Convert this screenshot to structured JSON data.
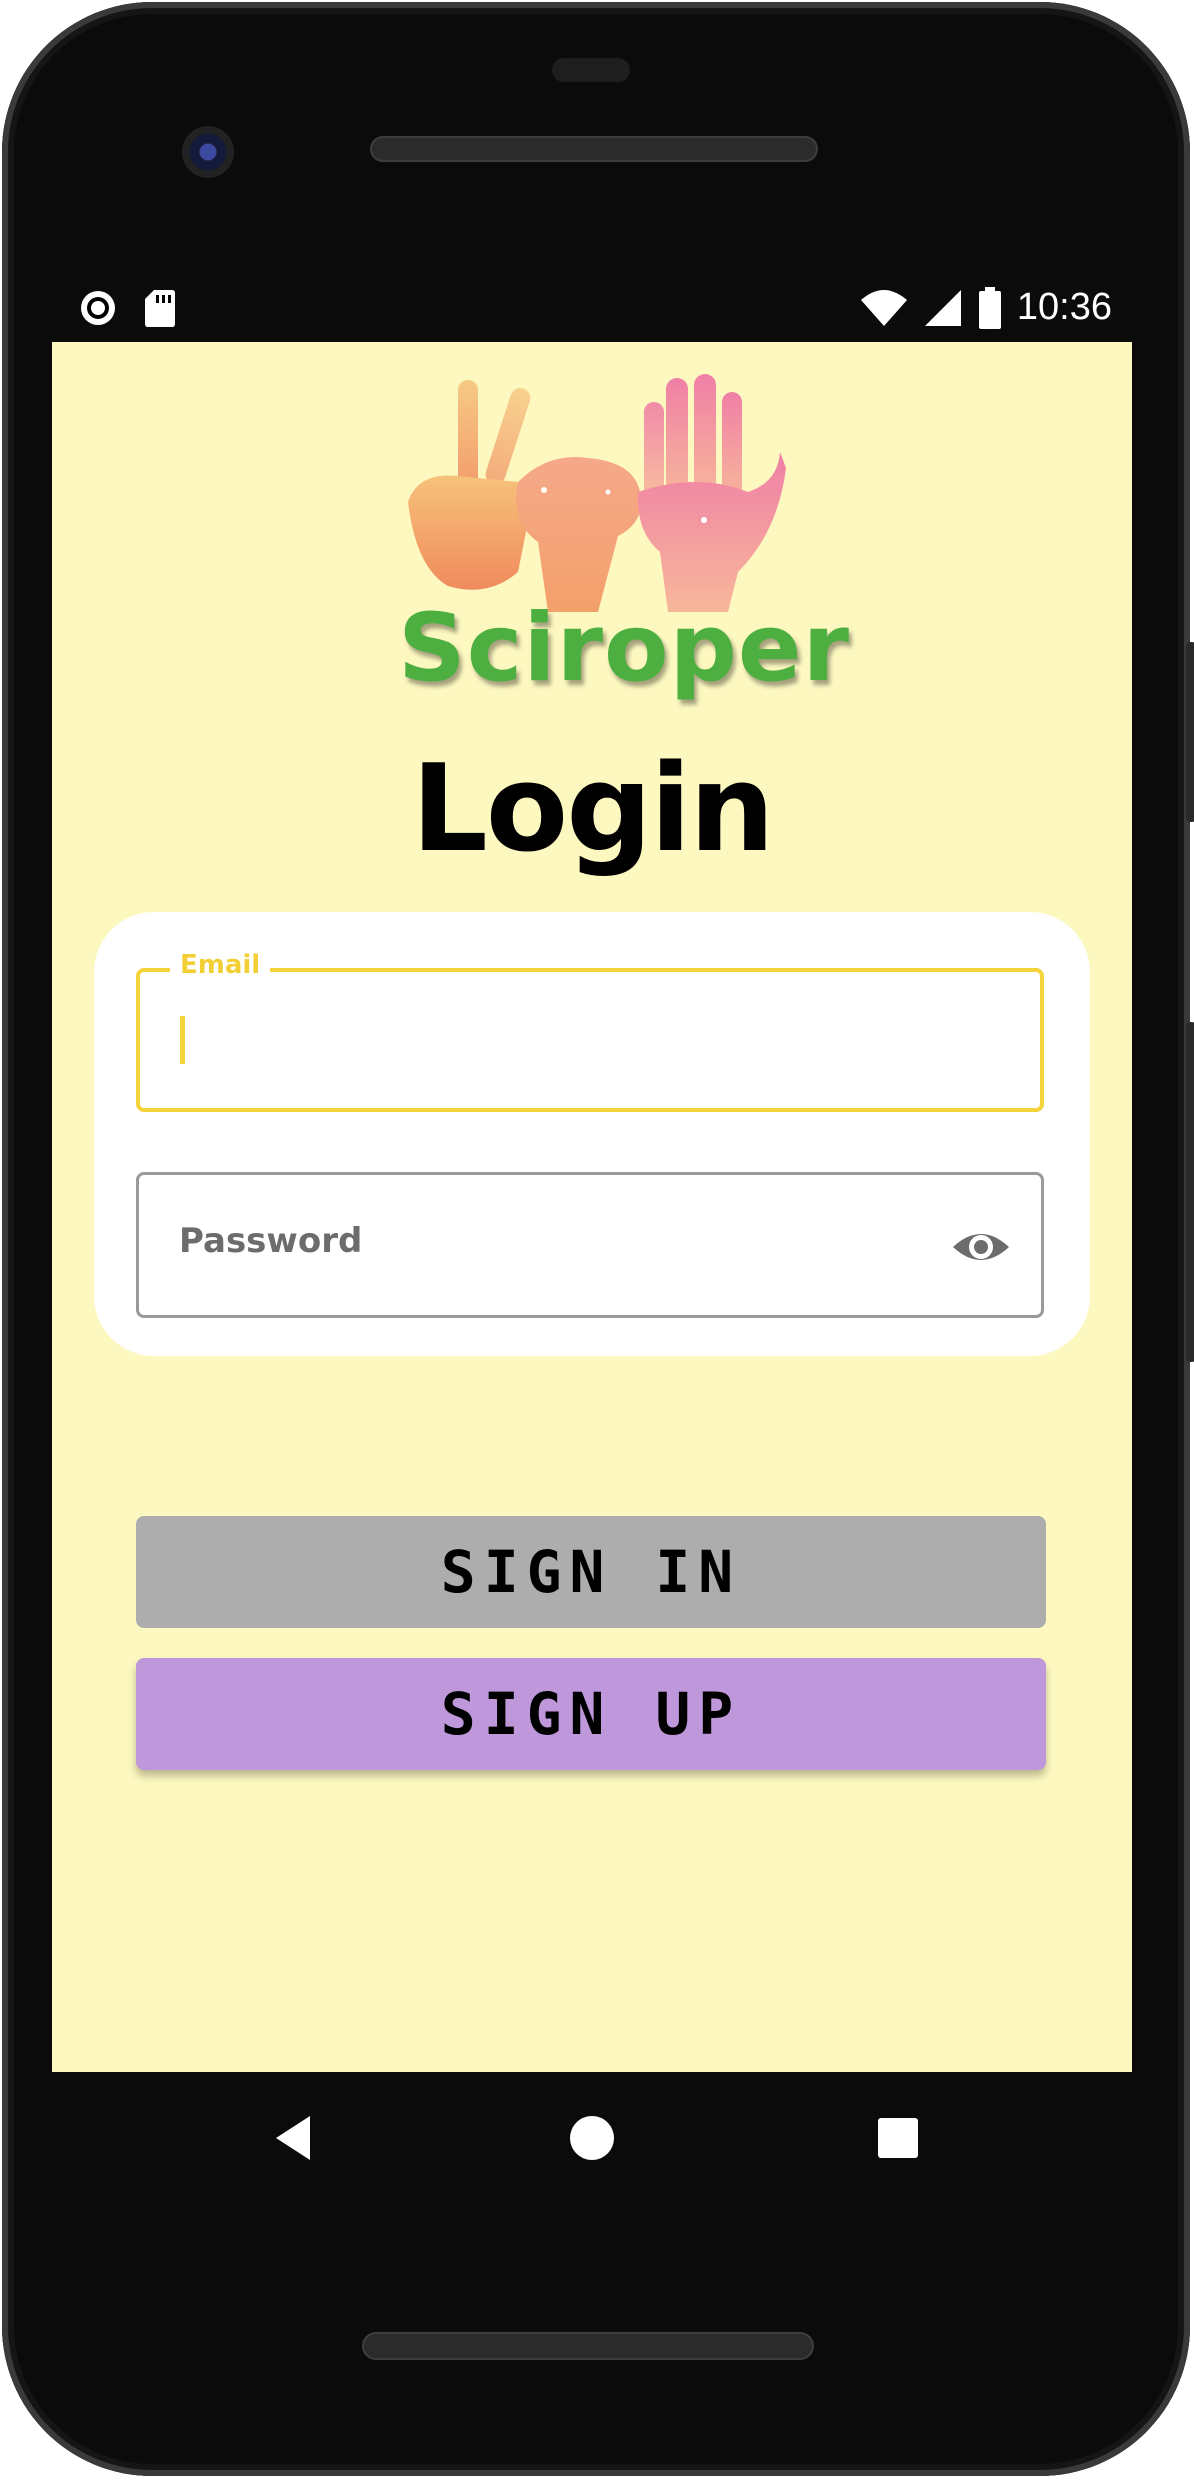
{
  "status_bar": {
    "time": "10:36",
    "left_icons": [
      "record-icon",
      "sd-card-icon"
    ],
    "right_icons": [
      "wifi-icon",
      "cell-signal-icon",
      "battery-icon"
    ]
  },
  "app": {
    "brand_name": "Sciroper",
    "page_title": "Login",
    "colors": {
      "background": "#fdf8c0",
      "brand_green": "#4caf3f",
      "focus_yellow": "#f5d43b",
      "sign_in_button": "#adadad",
      "sign_up_button": "#be98db"
    }
  },
  "form": {
    "email": {
      "label": "Email",
      "value": ""
    },
    "password": {
      "placeholder": "Password",
      "value": "",
      "toggle_icon": "eye-icon"
    }
  },
  "buttons": {
    "sign_in": "SIGN IN",
    "sign_up": "SIGN UP"
  },
  "nav_bar": {
    "items": [
      "back-icon",
      "home-icon",
      "recents-icon"
    ]
  }
}
